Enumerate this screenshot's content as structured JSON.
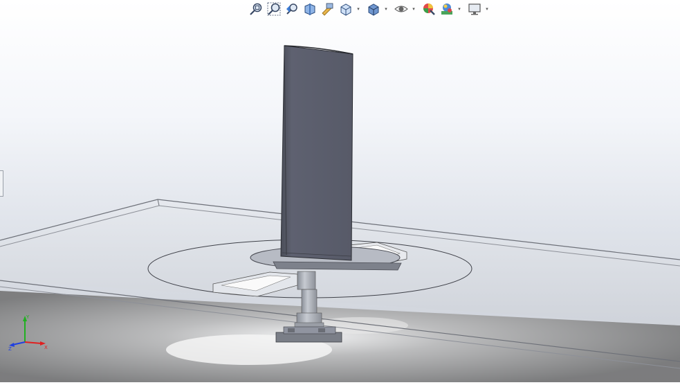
{
  "window": {
    "title": ""
  },
  "toolbar": {
    "buttons": [
      {
        "name": "zoom-to-fit",
        "icon": "zoom-fit-icon"
      },
      {
        "name": "zoom-to-area",
        "icon": "zoom-area-icon"
      },
      {
        "name": "previous-view",
        "icon": "previous-view-icon"
      },
      {
        "name": "section-view",
        "icon": "section-view-icon"
      },
      {
        "name": "dynamic-annotation-views",
        "icon": "annotation-views-icon"
      },
      {
        "name": "view-orientation",
        "icon": "view-orientation-icon",
        "dropdown": true
      },
      {
        "name": "display-style",
        "icon": "display-style-icon",
        "dropdown": true
      },
      {
        "name": "hide-show-items",
        "icon": "eye-icon",
        "dropdown": true
      },
      {
        "name": "edit-appearance",
        "icon": "appearance-icon"
      },
      {
        "name": "apply-scene",
        "icon": "scene-icon",
        "dropdown": true
      },
      {
        "name": "view-settings",
        "icon": "monitor-icon",
        "dropdown": true
      }
    ]
  },
  "colors": {
    "blade": "#5a5d6a",
    "plate": "#d8dbe2",
    "plate_edge": "#6d7078",
    "shadow": "#7a7a7a",
    "axis_x": "#e02020",
    "axis_y": "#20b020",
    "axis_z": "#2040e0"
  },
  "triad": {
    "x_label": "X",
    "y_label": "Y",
    "z_label": "Z"
  }
}
